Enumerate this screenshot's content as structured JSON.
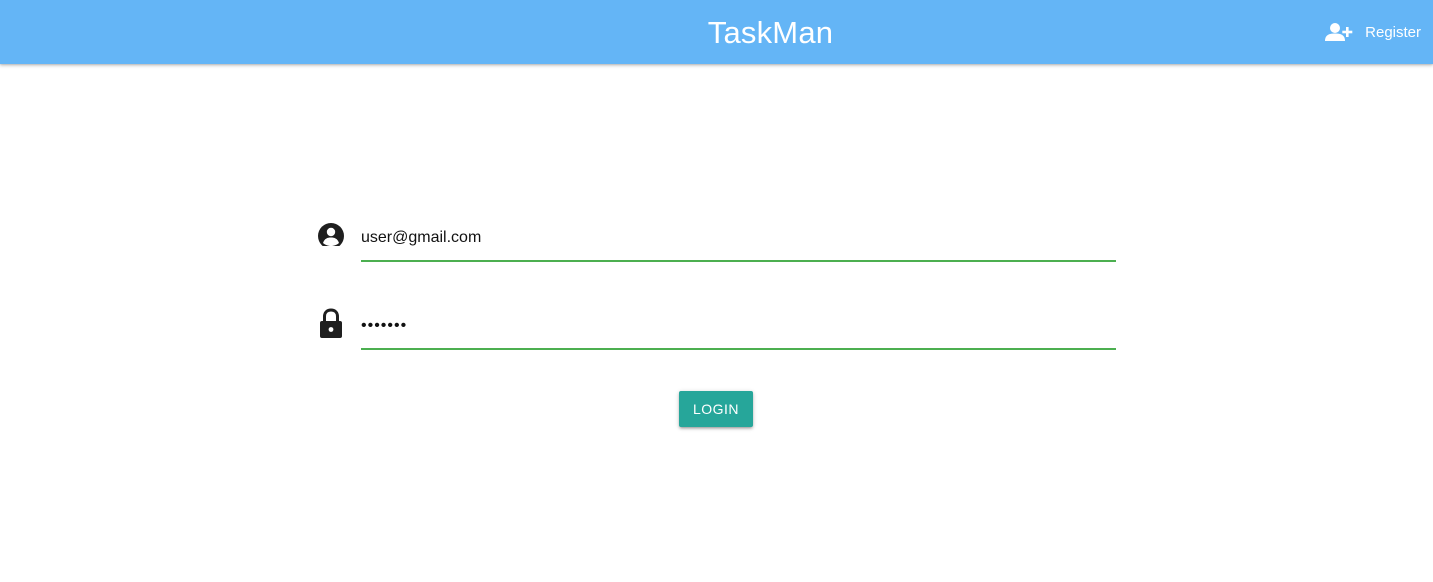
{
  "navbar": {
    "brand": "TaskMan",
    "register_label": "Register",
    "register_icon": "person-add-icon",
    "background": "#64b5f6"
  },
  "form": {
    "email": {
      "icon": "account-circle-icon",
      "value": "user@gmail.com"
    },
    "password": {
      "icon": "lock-icon",
      "value": "1234567"
    },
    "login_label": "LOGIN",
    "underline_color": "#4caf50",
    "button_color": "#26a69a"
  }
}
